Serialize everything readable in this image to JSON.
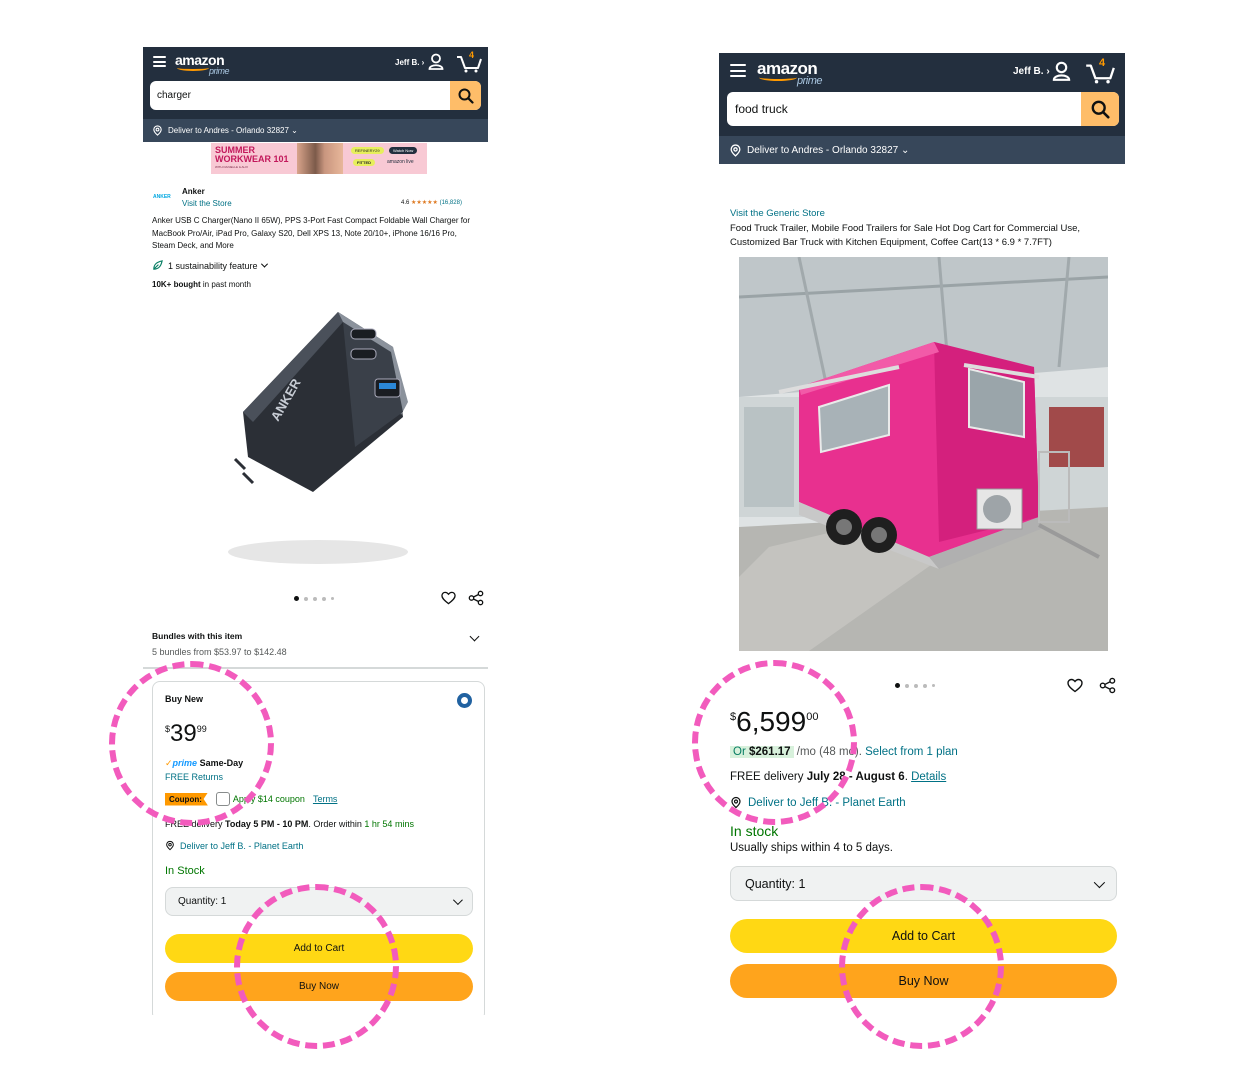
{
  "left": {
    "header": {
      "logo": "amazon",
      "logo_sub": "prime",
      "user": "Jeff B. ›",
      "cart_count": "4",
      "search_value": "charger",
      "deliver_to": "Deliver to Andres - Orlando 32827 ⌄"
    },
    "banner": {
      "line1": "SUMMER",
      "line2": "WORKWEAR 101",
      "sub": "WITH DANIELLE & ALIX",
      "tag1": "REFINERY29",
      "tag2": "FITTED",
      "tag3": "Watch Now",
      "tag4": "amazon live"
    },
    "brand": {
      "logo_text": "ANKER",
      "name": "Anker",
      "store_link": "Visit the Store",
      "rating": "4.6",
      "stars": "★★★★★",
      "review_count": "(16,828)"
    },
    "title": "Anker USB C Charger(Nano II 65W), PPS 3-Port Fast Compact Foldable Wall Charger for MacBook Pro/Air, iPad Pro, Galaxy S20, Dell XPS 13, Note 20/10+, iPhone 16/16 Pro, Steam Deck, and More",
    "sustainability": "1 sustainability feature",
    "bought_bold": "10K+ bought",
    "bought_rest": " in past month",
    "product_image_alt": "Anker charger",
    "bundles": {
      "title": "Bundles with this item",
      "sub": "5 bundles from $53.97 to $142.48"
    },
    "buy_new": "Buy New",
    "price": {
      "symbol": "$",
      "whole": "39",
      "fraction": "99"
    },
    "prime_check": "✓",
    "prime_word": "prime",
    "prime_tail": " Same-Day",
    "free_returns": "FREE Returns",
    "coupon_badge": "Coupon:",
    "coupon_text": "Apply $14 coupon",
    "terms": "Terms",
    "delivery_prefix": "FREE delivery ",
    "delivery_bold": "Today 5 PM - 10 PM",
    "delivery_mid": ". Order within ",
    "delivery_time": "1 hr 54 mins",
    "deliver_to_link": "Deliver to Jeff B. - Planet Earth",
    "stock": "In Stock",
    "quantity": "Quantity: 1",
    "add_to_cart": "Add to Cart",
    "buy_now": "Buy Now"
  },
  "right": {
    "header": {
      "logo": "amazon",
      "logo_sub": "prime",
      "user": "Jeff B. ›",
      "cart_count": "4",
      "search_value": "food truck",
      "deliver_to": "Deliver to Andres - Orlando 32827 ⌄"
    },
    "store_link": "Visit the Generic Store",
    "title": "Food Truck Trailer, Mobile Food Trailers for Sale Hot Dog Cart for Commercial Use, Customized Bar Truck with Kitchen Equipment, Coffee Cart(13 * 6.9 * 7.7FT)",
    "product_image_alt": "Pink food truck trailer",
    "price": {
      "symbol": "$",
      "whole": "6,599",
      "fraction": "00"
    },
    "monthly_prefix": "Or ",
    "monthly_amount": "$261.17",
    "monthly_rest": " /mo (48 mo). ",
    "select_plan": "Select from 1 plan",
    "delivery_prefix": "FREE delivery ",
    "delivery_bold": "July 28 - August 6",
    "delivery_dot": ". ",
    "details": "Details",
    "deliver_to_link": "Deliver to Jeff B. - Planet Earth",
    "stock": "In stock",
    "ships": "Usually ships within 4 to 5 days.",
    "quantity": "Quantity: 1",
    "add_to_cart": "Add to Cart",
    "buy_now": "Buy Now"
  },
  "colors": {
    "header_bg": "#232f3e",
    "deliver_bg": "#37475a",
    "search_btn": "#febd69",
    "add_to_cart": "#ffd814",
    "buy_now": "#ffa41c",
    "annotation": "#f25bbd",
    "link": "#007185",
    "in_stock": "#007600"
  }
}
